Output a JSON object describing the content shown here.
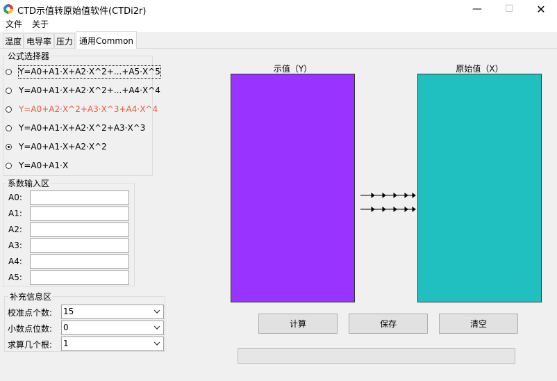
{
  "window": {
    "title": "CTD示值转原始值软件(CTDi2r)",
    "minimize": "—",
    "maximize": "☐",
    "close": "✕"
  },
  "menu": [
    "文件",
    "关于"
  ],
  "tabs": [
    "温度",
    "电导率",
    "压力",
    "通用Common"
  ],
  "formula_group": {
    "title": "公式选择器",
    "options": [
      {
        "label": "Y=A0+A1·X+A2·X^2+...+A5·X^5",
        "checked": false,
        "highlight": false,
        "focused": true
      },
      {
        "label": "Y=A0+A1·X+A2·X^2+...+A4·X^4",
        "checked": false,
        "highlight": false,
        "focused": false
      },
      {
        "label": "Y=A0+A2·X^2+A3·X^3+A4·X^4",
        "checked": false,
        "highlight": true,
        "focused": false
      },
      {
        "label": "Y=A0+A1·X+A2·X^2+A3·X^3",
        "checked": false,
        "highlight": false,
        "focused": false
      },
      {
        "label": "Y=A0+A1·X+A2·X^2",
        "checked": true,
        "highlight": false,
        "focused": false
      },
      {
        "label": "Y=A0+A1·X",
        "checked": false,
        "highlight": false,
        "focused": false
      }
    ]
  },
  "coef_group": {
    "title": "系数输入区",
    "fields": [
      {
        "label": "A0:",
        "value": ""
      },
      {
        "label": "A1:",
        "value": ""
      },
      {
        "label": "A2:",
        "value": ""
      },
      {
        "label": "A3:",
        "value": ""
      },
      {
        "label": "A4:",
        "value": ""
      },
      {
        "label": "A5:",
        "value": ""
      }
    ]
  },
  "extra_group": {
    "title": "补充信息区",
    "fields": [
      {
        "label": "校准点个数:",
        "value": "15"
      },
      {
        "label": "小数点位数:",
        "value": "0"
      },
      {
        "label": "求算几个根:",
        "value": "1"
      }
    ]
  },
  "panels": {
    "left_label": "示值（Y）",
    "right_label": "原始值（X）",
    "left_color": "#9933ff",
    "right_color": "#20c0c0"
  },
  "buttons": {
    "calc": "计算",
    "save": "保存",
    "clear": "清空"
  },
  "progress": {
    "fraction": 0
  }
}
